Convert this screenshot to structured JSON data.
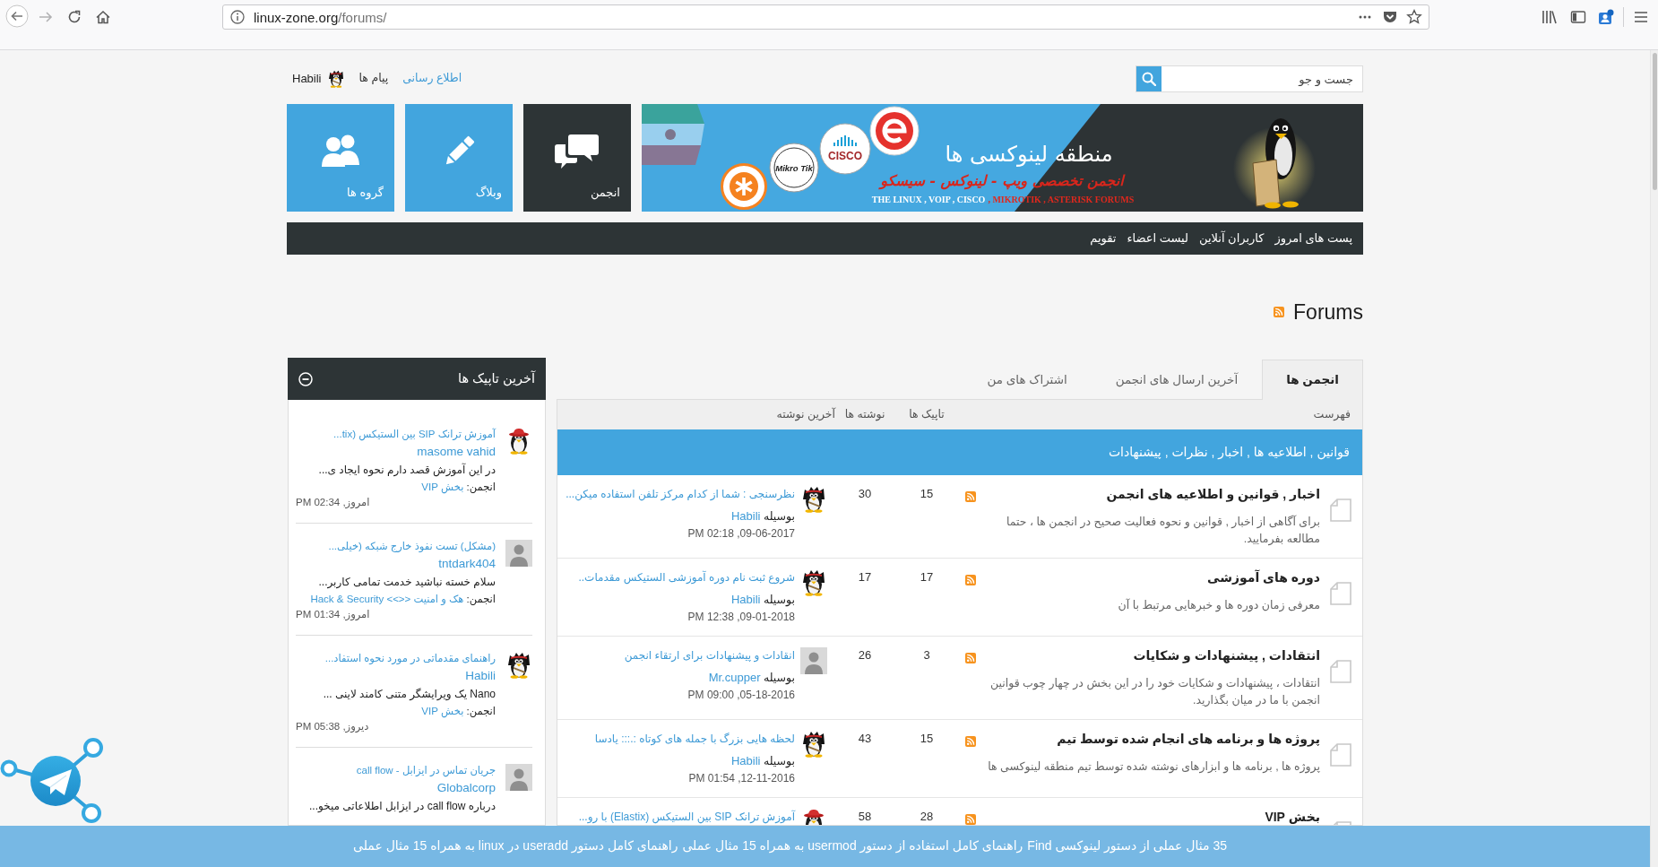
{
  "browser": {
    "url": {
      "host": "linux-zone.org",
      "path": "/forums/"
    }
  },
  "header": {
    "search": {
      "placeholder": "جست و جو"
    },
    "user_links": [
      {
        "label": "اطلاع رسانی",
        "highlighted": true
      },
      {
        "label": "پیام ها",
        "highlighted": false
      }
    ],
    "user": {
      "name": "Habili",
      "avatar": {
        "kind": "penguin"
      }
    }
  },
  "banner": {
    "title": "منطقه لینوکسی ها",
    "subtitle": "انجمن تخصصی ویپ - لینوکس - سیسکو",
    "tagline": "THE LINUX , VOIP , CISCO",
    "tagline_highlight": ", MIKROTIK , ASTERISK FORUMS",
    "logos": [
      {
        "kind": "asterisk"
      },
      {
        "kind": "mikrotik",
        "text": "Mikro Tik"
      },
      {
        "kind": "cisco",
        "text": "CISCO"
      },
      {
        "kind": "letter-e"
      }
    ]
  },
  "tiles": [
    {
      "kind": "forum",
      "label": "انجمن",
      "selected": true
    },
    {
      "kind": "blog",
      "label": "وبلاگ",
      "selected": false
    },
    {
      "kind": "groups",
      "label": "گروه ها",
      "selected": false
    }
  ],
  "nav": [
    "پست های امروز",
    "کاربران آنلاین",
    "لیست اعضاء",
    "تقویم"
  ],
  "page_title": "Forums",
  "tabs": [
    {
      "label": "انجمن ها",
      "selected": true
    },
    {
      "label": "آخرین ارسال های انجمن",
      "selected": false
    },
    {
      "label": "اشتراک های من",
      "selected": false
    }
  ],
  "table": {
    "columns": [
      "فهرست",
      "تاپیک ها",
      "نوشته ها",
      "آخرین نوشته"
    ],
    "category": "قوانین , اطلاعیه ها , اخبار , نظرات , پیشنهادات",
    "rows": [
      {
        "title": "اخبار , قوانین و اطلاعیه های انجمن",
        "description": "برای آگاهی از اخبار , قوانین و نحوه فعالیت صحیح در انجمن ها ، حتما مطالعه بفرمایید.",
        "topics": "15",
        "posts": "30",
        "last_post": {
          "title": "نظرسنجی : شما از کدام مرکز تلفن استفاده میکن...",
          "by_label": "بوسیله",
          "author": "Habili",
          "date": "09-06-2017, 02:18 PM",
          "avatar": {
            "kind": "penguin"
          }
        }
      },
      {
        "title": "دوره های آموزشی",
        "description": "معرفی زمان دوره ها و خبرهایی مرتبط با آن",
        "topics": "17",
        "posts": "17",
        "last_post": {
          "title": "شروع ثبت نام دوره آموزشی الستیکس مقدمات..",
          "by_label": "بوسیله",
          "author": "Habili",
          "date": "09-01-2018, 12:38 PM",
          "avatar": {
            "kind": "penguin"
          }
        }
      },
      {
        "title": "انتقادات , پیشنهادات و شکایات",
        "description": "انتقادات ، پیشنهادات و شکایات خود را در این بخش در چهار چوب قوانین انجمن با ما در میان بگذارید.",
        "topics": "3",
        "posts": "26",
        "last_post": {
          "title": "انقادات و پیشنهادات برای ارتقاء انجمن",
          "by_label": "بوسیله",
          "author": "Mr.cupper",
          "date": "05-18-2016, 09:00 PM",
          "avatar": {
            "kind": "generic"
          }
        }
      },
      {
        "title": "پروژه ها و برنامه های انجام شده توسط تیم",
        "description": "پروژه ها , برنامه ها و ابزارهای نوشته شده توسط تیم منطقه لینوکسی ها",
        "topics": "15",
        "posts": "43",
        "last_post": {
          "title": "لحظه هایی بزرگ با جمله های کوتاه :.::: یادسا",
          "by_label": "بوسیله",
          "author": "Habili",
          "date": "12-11-2016, 01:54 PM",
          "avatar": {
            "kind": "penguin"
          }
        }
      },
      {
        "title": "بخش VIP",
        "topics": "28",
        "posts": "58",
        "last_post": {
          "title": "آموزش ترانک SIP بین الستیکس (Elastix) با رو...",
          "avatar": {
            "kind": "hat-penguin"
          }
        }
      }
    ]
  },
  "sidebar": {
    "title": "آخرین تاپیک ها",
    "items": [
      {
        "title": "آموزش ترانک SIP بین الستیکس (tix...",
        "author": "masome vahid",
        "excerpt": "در این آموزش قصد دارم نحوه ایجاد ی...",
        "forum_label": "انجمن:",
        "forum": "بخش VIP",
        "time": "امروز, 02:34 PM",
        "avatar": {
          "kind": "hat-penguin"
        }
      },
      {
        "title": "(مشکل) تست نفوذ خارج شبکه (خیلی...",
        "author": "tntdark404",
        "excerpt": "سلام خسته نباشید خدمت تمامی کاربر...",
        "forum_label": "انجمن:",
        "forum": "هک و امنیت <<>> Hack & Security",
        "time": "امروز, 01:34 PM",
        "avatar": {
          "kind": "generic"
        }
      },
      {
        "title": "راهنمای مقدماتی در مورد نحوه استفاد...",
        "author": "Habili",
        "excerpt": "Nano یک ویرایشگر متنی کامند لاینی ...",
        "forum_label": "انجمن:",
        "forum": "بخش VIP",
        "time": "دیروز, 05:38 PM",
        "avatar": {
          "kind": "penguin"
        }
      },
      {
        "title": "جریان تماس در ایزابل - call flow",
        "author": "Globalcorp",
        "excerpt": "درباره call flow در ایزابل اطلاعاتی میخو...",
        "avatar": {
          "kind": "generic"
        }
      }
    ]
  },
  "ticker": [
    "35 مثال عملی از دستور لینوکسی Find",
    "راهنمای کامل استفاده از دستور usermod به همراه 15 مثال عملی",
    "راهنمای کامل دستور useradd در linux به همراه 15 مثال عملی"
  ]
}
